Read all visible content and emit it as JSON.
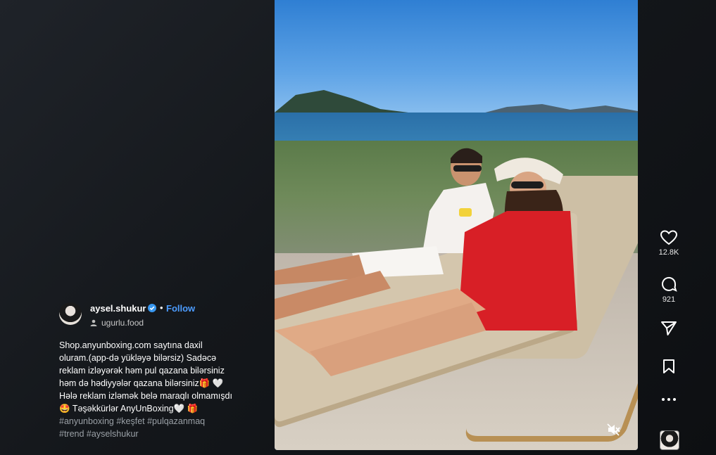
{
  "post": {
    "username": "aysel.shukur",
    "separator": "•",
    "follow_label": "Follow",
    "audio_label": "ugurlu.food",
    "caption_lines": [
      "Shop.anyunboxing.com saytına daxil",
      "oluram.(app-də yükləyə bilərsiz) Sadəcə",
      "reklam izləyərək həm pul qazana bilərsiniz",
      "həm də hədiyyələr qazana bilərsiniz🎁 🤍",
      "Hələ reklam izləmək belə maraqlı olmamışdı",
      "🤩 Təşəkkürlər AnyUnBoxing🤍 🎁"
    ],
    "hashtags": [
      "#anyunboxing #keşfet #pulqazanmaq",
      "#trend #ayselshukur"
    ]
  },
  "actions": {
    "likes": "12.8K",
    "comments": "921"
  },
  "icons": {
    "like": "heart-icon",
    "comment": "comment-icon",
    "share": "share-icon",
    "save": "bookmark-icon",
    "more": "more-icon",
    "mute": "mute-icon",
    "verified": "verified-badge-icon"
  },
  "colors": {
    "follow": "#4c9cff",
    "verified": "#3897f0",
    "dress": "#d81f26"
  }
}
